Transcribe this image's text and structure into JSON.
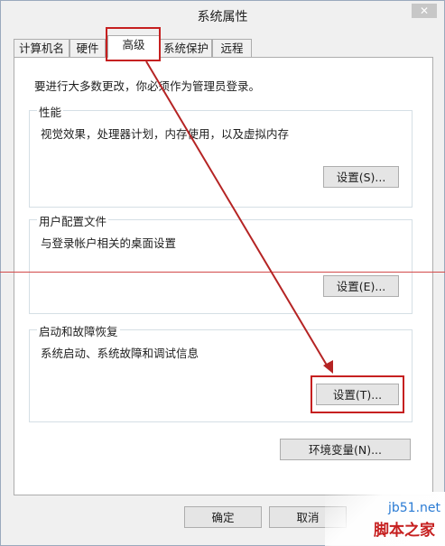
{
  "window": {
    "title": "系统属性",
    "close_glyph": "✕"
  },
  "tabs": [
    {
      "label": "计算机名"
    },
    {
      "label": "硬件"
    },
    {
      "label": "高级",
      "active": true
    },
    {
      "label": "系统保护"
    },
    {
      "label": "远程"
    }
  ],
  "notice": "要进行大多数更改，你必须作为管理员登录。",
  "groups": {
    "performance": {
      "title": "性能",
      "desc": "视觉效果，处理器计划，内存使用，以及虚拟内存",
      "button": "设置(S)..."
    },
    "profiles": {
      "title": "用户配置文件",
      "desc": "与登录帐户相关的桌面设置",
      "button": "设置(E)..."
    },
    "startup": {
      "title": "启动和故障恢复",
      "desc": "系统启动、系统故障和调试信息",
      "button": "设置(T)..."
    }
  },
  "env_button": "环境变量(N)...",
  "footer": {
    "ok": "确定",
    "cancel": "取消"
  },
  "watermark": {
    "domain": "jb51.net",
    "name": "脚本之家"
  },
  "colors": {
    "highlight": "#c62020",
    "panel": "#ffffff",
    "window": "#f0f0f0"
  }
}
